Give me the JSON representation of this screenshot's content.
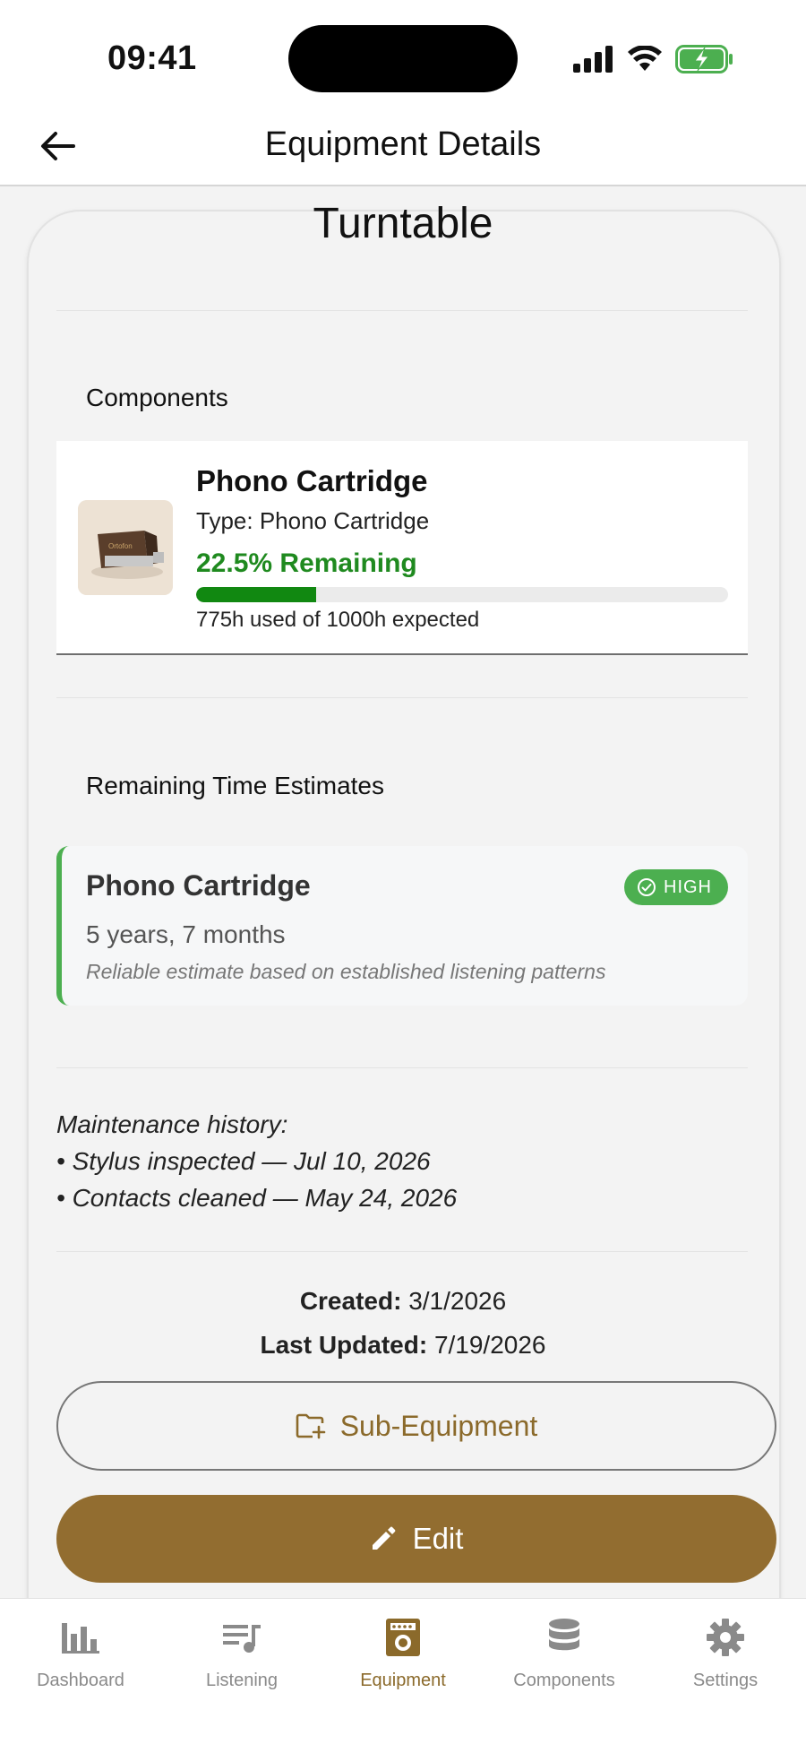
{
  "status_bar": {
    "time": "09:41"
  },
  "header": {
    "title": "Equipment Details"
  },
  "equipment": {
    "name": "Turntable"
  },
  "components_section": {
    "heading": "Components",
    "items": [
      {
        "name": "Phono Cartridge",
        "type": "Type: Phono Cartridge",
        "remaining_label": "22.5% Remaining",
        "remaining_fraction": 0.225,
        "usage": "775h used of 1000h expected",
        "thumbnail_text": "Ortofon"
      }
    ]
  },
  "estimates_section": {
    "heading": "Remaining Time Estimates",
    "items": [
      {
        "name": "Phono Cartridge",
        "confidence": "HIGH",
        "duration": "5 years, 7 months",
        "note": "Reliable estimate based on established listening patterns"
      }
    ]
  },
  "maintenance": {
    "title": "Maintenance history:",
    "entries": [
      "• Stylus inspected — Jul 10, 2026",
      "• Contacts cleaned — May 24, 2026"
    ]
  },
  "dates": {
    "created_label": "Created:",
    "created_value": "3/1/2026",
    "updated_label": "Last Updated:",
    "updated_value": "7/19/2026"
  },
  "actions": {
    "sub_equipment_label": "Sub-Equipment",
    "edit_label": "Edit"
  },
  "tab_bar": {
    "tabs": [
      {
        "label": "Dashboard",
        "icon": "bar-chart-icon",
        "active": false
      },
      {
        "label": "Listening",
        "icon": "playlist-icon",
        "active": false
      },
      {
        "label": "Equipment",
        "icon": "amplifier-icon",
        "active": true
      },
      {
        "label": "Components",
        "icon": "database-icon",
        "active": false
      },
      {
        "label": "Settings",
        "icon": "gear-icon",
        "active": false
      }
    ]
  },
  "colors": {
    "accent": "#926d30",
    "accent_text": "#8b6a2b",
    "success": "#1f8a1f",
    "progress": "#118811",
    "badge": "#4caf50",
    "inactive_tab": "#8a8a8a"
  }
}
